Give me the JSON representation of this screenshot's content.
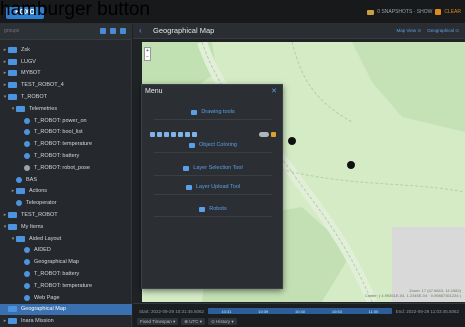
{
  "overlay_label": "hamburger button",
  "appbar": {
    "logo_text": "FOXO",
    "snapshot_label": "0 SNAPSHOTS · SHOW",
    "clear_label": "CLEAR"
  },
  "sidebar": {
    "search_placeholder": "groups",
    "rows": [
      {
        "indent": 1,
        "chev": "▸",
        "icon": "folder",
        "label": "Zsk"
      },
      {
        "indent": 1,
        "chev": "▸",
        "icon": "folder",
        "label": "LUGV"
      },
      {
        "indent": 1,
        "chev": "▸",
        "icon": "folder",
        "label": "MYBOT"
      },
      {
        "indent": 1,
        "chev": "▸",
        "icon": "folder",
        "label": "TEST_ROBOT_4"
      },
      {
        "indent": 1,
        "chev": "▾",
        "icon": "folder",
        "label": "T_ROBOT"
      },
      {
        "indent": 2,
        "chev": "▾",
        "icon": "folder",
        "label": "Telemetries"
      },
      {
        "indent": 3,
        "chev": "",
        "icon": "item",
        "label": "T_ROBOT: power_on"
      },
      {
        "indent": 3,
        "chev": "",
        "icon": "item",
        "label": "T_ROBOT: bool_list"
      },
      {
        "indent": 3,
        "chev": "",
        "icon": "item",
        "label": "T_ROBOT: temperature"
      },
      {
        "indent": 3,
        "chev": "",
        "icon": "item",
        "label": "T_ROBOT: battery"
      },
      {
        "indent": 3,
        "chev": "",
        "icon": "grey",
        "label": "T_ROBOT: robot_pose"
      },
      {
        "indent": 2,
        "chev": "",
        "icon": "item",
        "label": "BAS"
      },
      {
        "indent": 2,
        "chev": "▸",
        "icon": "folder",
        "label": "Actions"
      },
      {
        "indent": 2,
        "chev": "",
        "icon": "item",
        "label": "Teleoperator"
      },
      {
        "indent": 1,
        "chev": "▸",
        "icon": "folder",
        "label": "TEST_ROBOT"
      },
      {
        "indent": 1,
        "chev": "▾",
        "icon": "folder",
        "label": "My Items"
      },
      {
        "indent": 2,
        "chev": "▾",
        "icon": "folder",
        "label": "Aided Layout"
      },
      {
        "indent": 3,
        "chev": "",
        "icon": "item",
        "label": "AIDED"
      },
      {
        "indent": 3,
        "chev": "",
        "icon": "item",
        "label": "Geographical Map"
      },
      {
        "indent": 3,
        "chev": "",
        "icon": "item",
        "label": "T_ROBOT: battery"
      },
      {
        "indent": 3,
        "chev": "",
        "icon": "item",
        "label": "T_ROBOT: temperature"
      },
      {
        "indent": 3,
        "chev": "",
        "icon": "item",
        "label": "Web Page"
      },
      {
        "indent": 1,
        "chev": "",
        "icon": "folder",
        "label": "Geographical Map",
        "selected": true
      },
      {
        "indent": 1,
        "chev": "▸",
        "icon": "folder",
        "label": "Inara Mission"
      }
    ]
  },
  "main": {
    "back_glyph": "‹",
    "title": "Geographical Map",
    "head_links": [
      "Map View ⊙",
      "Geographical ⊙"
    ]
  },
  "map": {
    "zoom_plus": "+",
    "zoom_minus": "−",
    "attrib_line1": "Zoom: 17 (47.6843, 14.1582) ",
    "attrib_line2": "Center: ( 4.99351E-04, 1.2345E-04 · 0.99887351234 )"
  },
  "menu": {
    "title": "Menu",
    "close_glyph": "✕",
    "items": [
      {
        "label": "Drawing tools"
      },
      {
        "label": "Object Coloring"
      },
      {
        "label": "Layer Selection Tool"
      },
      {
        "label": "Layer Upload Tool"
      },
      {
        "label": "Robots"
      }
    ]
  },
  "timeline": {
    "start_label": "Start: 2022-09-29 10:31:45.5062",
    "ticks": [
      "10:31",
      "10:39",
      "10:40",
      "10:53",
      "11:00"
    ],
    "end_label": "End: 2022-09-29 11:03:45.5062",
    "pills": [
      "Fixed Timespan ▾",
      "⊕ UTC ▾",
      "⊙ History ▾"
    ]
  }
}
